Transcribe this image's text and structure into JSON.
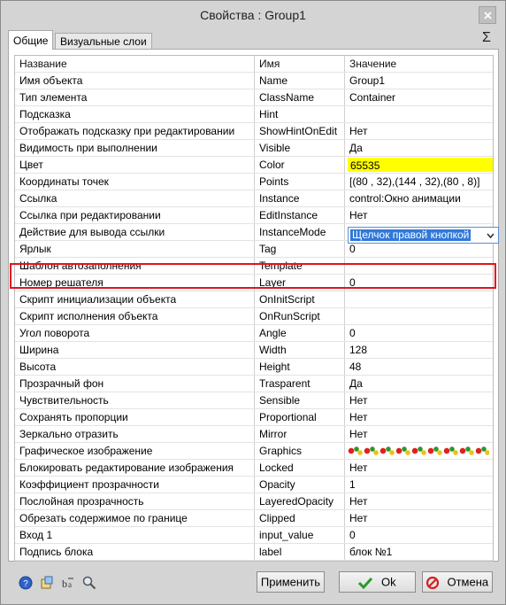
{
  "window": {
    "title": "Свойства :   Group1"
  },
  "tabs": [
    {
      "label": "Общие",
      "active": true
    },
    {
      "label": "Визуальные слои",
      "active": false
    }
  ],
  "sigma_glyph": "Σ",
  "grid": {
    "columns": [
      "Название",
      "Имя",
      "Значение"
    ],
    "rows": [
      {
        "name": "Имя объекта",
        "id": "Name",
        "value": "Group1"
      },
      {
        "name": "Тип элемента",
        "id": "ClassName",
        "value": "Container"
      },
      {
        "name": "Подсказка",
        "id": "Hint",
        "value": ""
      },
      {
        "name": "Отображать подсказку при редактировании",
        "id": "ShowHintOnEdit",
        "value": "Нет"
      },
      {
        "name": "Видимость при выполнении",
        "id": "Visible",
        "value": "Да"
      },
      {
        "name": "Цвет",
        "id": "Color",
        "value": "65535"
      },
      {
        "name": "Координаты точек",
        "id": "Points",
        "value": "[(80 , 32),(144 , 32),(80 , 8)]"
      },
      {
        "name": "Ссылка",
        "id": "Instance",
        "value": "control:Окно анимации"
      },
      {
        "name": "Ссылка при редактировании",
        "id": "EditInstance",
        "value": "Нет"
      },
      {
        "name": "Действие для вывода ссылки",
        "id": "InstanceMode",
        "value": "Щелчок правой кнопкой"
      },
      {
        "name": "Ярлык",
        "id": "Tag",
        "value": "0"
      },
      {
        "name": "Шаблон автозаполнения",
        "id": "Template",
        "value": ""
      },
      {
        "name": "Номер решателя",
        "id": "Layer",
        "value": "0"
      },
      {
        "name": "Скрипт инициализации объекта",
        "id": "OnInitScript",
        "value": ""
      },
      {
        "name": "Скрипт исполнения объекта",
        "id": "OnRunScript",
        "value": ""
      },
      {
        "name": "Угол поворота",
        "id": "Angle",
        "value": "0"
      },
      {
        "name": "Ширина",
        "id": "Width",
        "value": "128"
      },
      {
        "name": "Высота",
        "id": "Height",
        "value": "48"
      },
      {
        "name": "Прозрачный фон",
        "id": "Trasparent",
        "value": "Да"
      },
      {
        "name": "Чувствительность",
        "id": "Sensible",
        "value": "Нет"
      },
      {
        "name": "Сохранять пропорции",
        "id": "Proportional",
        "value": "Нет"
      },
      {
        "name": "Зеркально отразить",
        "id": "Mirror",
        "value": "Нет"
      },
      {
        "name": "Графическое изображение",
        "id": "Graphics",
        "value": ""
      },
      {
        "name": "Блокировать редактирование изображения",
        "id": "Locked",
        "value": "Нет"
      },
      {
        "name": "Коэффициент прозрачности",
        "id": "Opacity",
        "value": "1"
      },
      {
        "name": "Послойная прозрачность",
        "id": "LayeredOpacity",
        "value": "Нет"
      },
      {
        "name": "Обрезать содержимое по границе",
        "id": "Clipped",
        "value": "Нет"
      },
      {
        "name": "Вход 1",
        "id": "input_value",
        "value": "0"
      },
      {
        "name": "Подпись блока",
        "id": "label",
        "value": "блок №1"
      }
    ]
  },
  "colors": {
    "color_cell": "#ffff00",
    "highlight": "#e0141e",
    "selection": "#3078d8"
  },
  "footer": {
    "icons": [
      "help-icon",
      "properties-icon",
      "text-format-icon",
      "search-icon"
    ],
    "apply_label": "Применить",
    "ok_label": "Ok",
    "cancel_label": "Отмена"
  }
}
